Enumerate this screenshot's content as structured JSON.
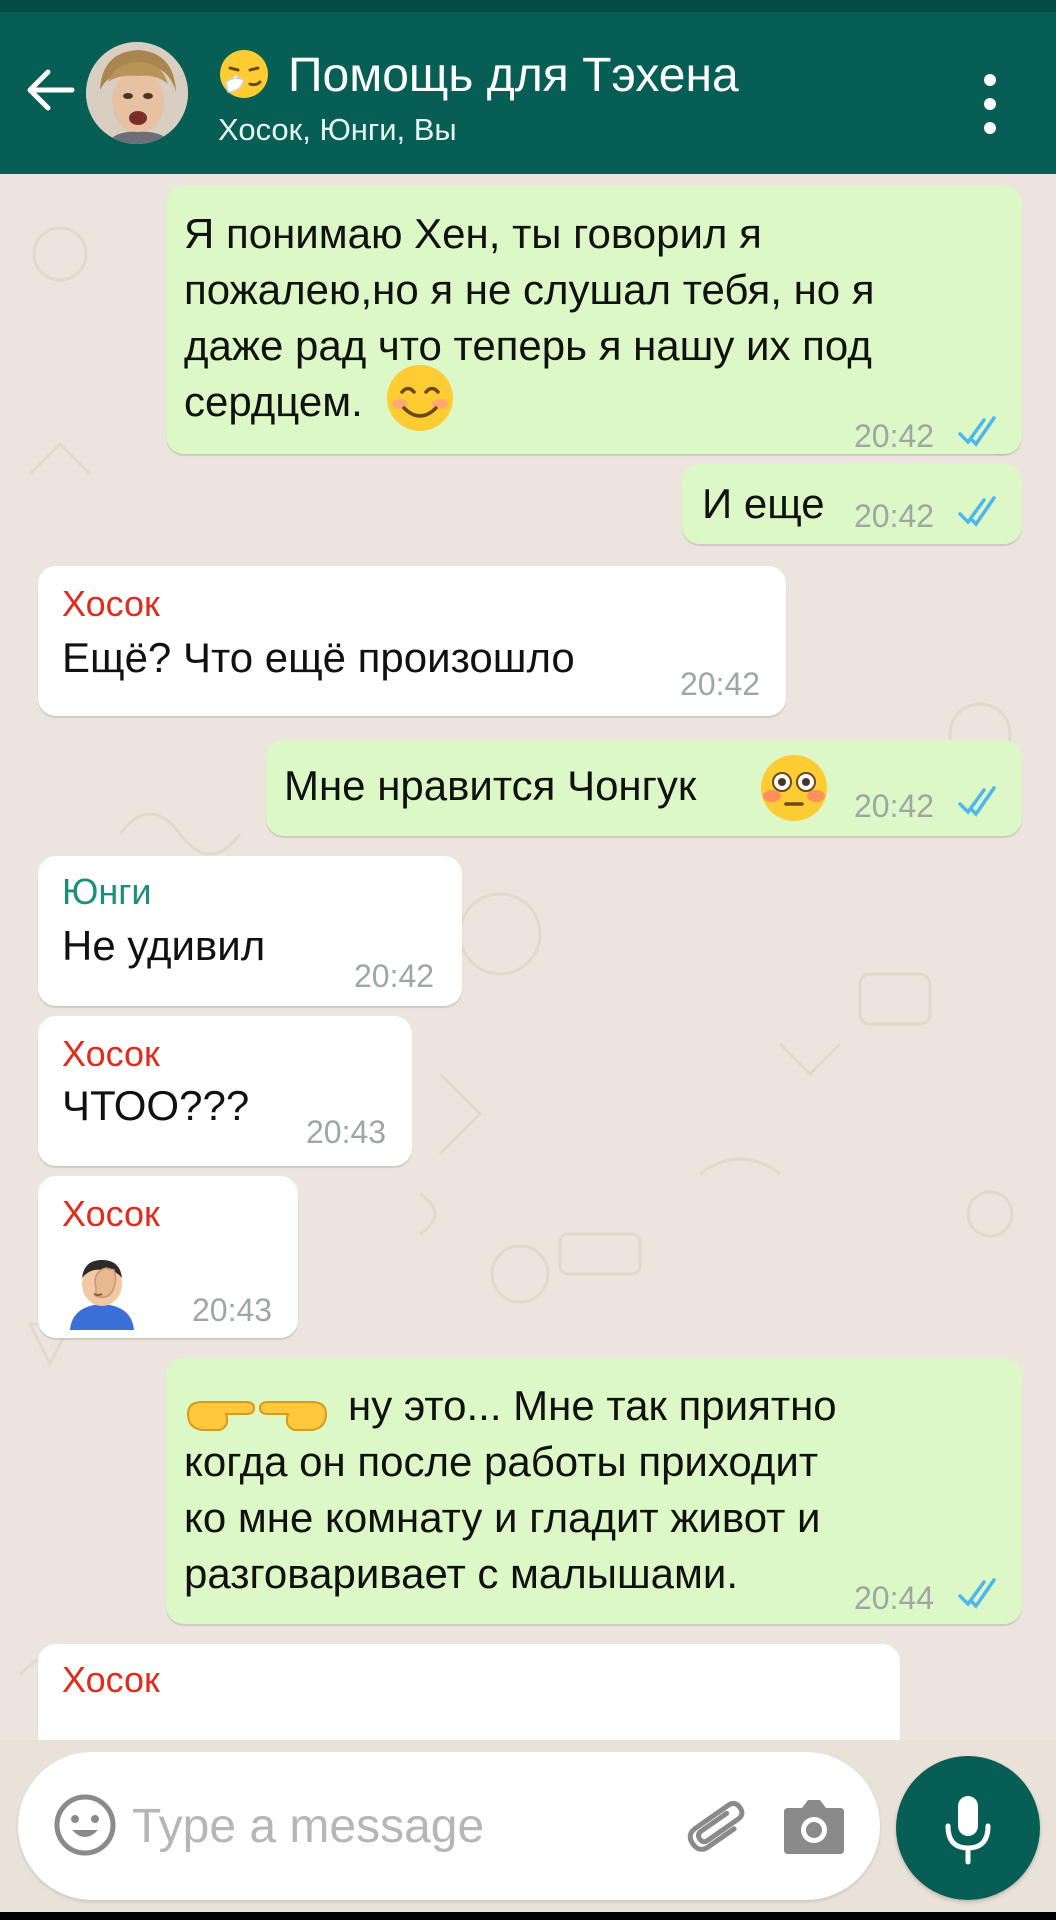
{
  "header": {
    "title": "Помощь для Тэхена",
    "subtitle": "Хосок, Юнги, Вы",
    "title_emoji": "sneezing-face",
    "avatar": "group-avatar-photo"
  },
  "colors": {
    "header": "#075e54",
    "outgoing_bubble": "#dcf8c6",
    "incoming_bubble": "#ffffff",
    "hoseok_name": "#e02b1d",
    "yoongi_name": "#1a8f7a",
    "read_ticks": "#4fb6ec"
  },
  "messages": [
    {
      "direction": "outgoing",
      "text": "Я понимаю Хен, ты говорил я\nпожалею,но я не слушал тебя, но я\nдаже рад что теперь я нашу их под\nсердцем.",
      "trailing_emoji": "smiling-face-with-smiling-eyes",
      "time": "20:42",
      "status": "read"
    },
    {
      "direction": "outgoing",
      "text": "И еще",
      "time": "20:42",
      "status": "read"
    },
    {
      "direction": "incoming",
      "sender": "Хосок",
      "text": "Ещё? Что ещё произошло",
      "time": "20:42"
    },
    {
      "direction": "outgoing",
      "text": "Мне нравится Чонгук",
      "trailing_emoji": "flushed-face",
      "time": "20:42",
      "status": "read"
    },
    {
      "direction": "incoming",
      "sender": "Юнги",
      "text": "Не удивил",
      "time": "20:42"
    },
    {
      "direction": "incoming",
      "sender": "Хосок",
      "text": "ЧТОО???",
      "time": "20:43"
    },
    {
      "direction": "incoming",
      "sender": "Хосок",
      "text": "",
      "emoji": "man-facepalming",
      "time": "20:43"
    },
    {
      "direction": "outgoing",
      "leading_emoji": "pointing-fingers",
      "text": "ну это... Мне так приятно\nкогда он после работы приходит\nко мне комнату и гладит живот и\nразговаривает с малышами.",
      "time": "20:44",
      "status": "read"
    },
    {
      "direction": "incoming",
      "sender": "Хосок",
      "text": "",
      "partial": true
    }
  ],
  "composer": {
    "placeholder": "Type a message",
    "value": ""
  },
  "icons": {
    "back": "arrow-left-icon",
    "menu": "more-vertical-icon",
    "emoji": "smiley-icon",
    "attach": "paperclip-icon",
    "camera": "camera-icon",
    "mic": "microphone-icon"
  }
}
